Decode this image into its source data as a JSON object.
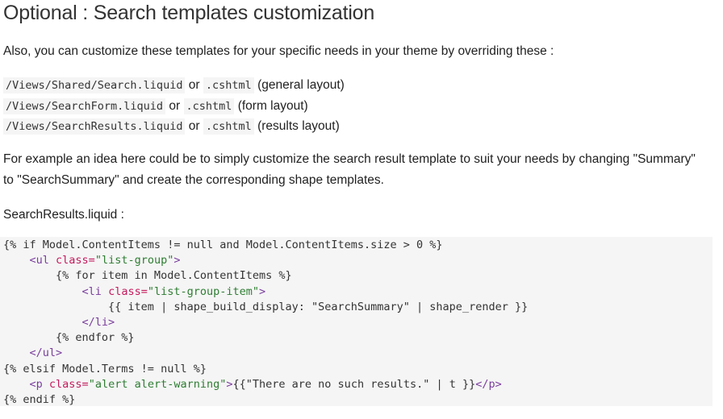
{
  "heading": "Optional : Search templates customization",
  "intro": "Also, you can customize these templates for your specific needs in your theme by overriding these :",
  "paths": [
    {
      "code1": "/Views/Shared/Search.liquid",
      "or": "or",
      "code2": ".cshtml",
      "note": "(general layout)"
    },
    {
      "code1": "/Views/SearchForm.liquid",
      "or": "or",
      "code2": ".cshtml",
      "note": "(form layout)"
    },
    {
      "code1": "/Views/SearchResults.liquid",
      "or": "or",
      "code2": ".cshtml",
      "note": "(results layout)"
    }
  ],
  "example": "For example an idea here could be to simply customize the search result template to suit your needs by changing \"Summary\" to \"SearchSummary\" and create the corresponding shape templates.",
  "file_label": "SearchResults.liquid :",
  "code": {
    "l1": "{% if Model.ContentItems != null and Model.ContentItems.size > 0 %}",
    "l2_indent": "    ",
    "l2_open": "<ul",
    "l2_attr": " class=",
    "l2_val": "\"list-group\"",
    "l2_close": ">",
    "l3": "        {% for item in Model.ContentItems %}",
    "l4_indent": "            ",
    "l4_open": "<li",
    "l4_attr": " class=",
    "l4_val": "\"list-group-item\"",
    "l4_close": ">",
    "l5": "                {{ item | shape_build_display: \"SearchSummary\" | shape_render }}",
    "l6_indent": "            ",
    "l6_tag": "</li>",
    "l7": "        {% endfor %}",
    "l8_indent": "    ",
    "l8_tag": "</ul>",
    "l9": "{% elsif Model.Terms != null %}",
    "l10_indent": "    ",
    "l10_open": "<p",
    "l10_attr": " class=",
    "l10_val": "\"alert alert-warning\"",
    "l10_gt": ">",
    "l10_text": "{{\"There are no such results.\" | t }}",
    "l10_close": "</p>",
    "l11": "{% endif %}"
  }
}
